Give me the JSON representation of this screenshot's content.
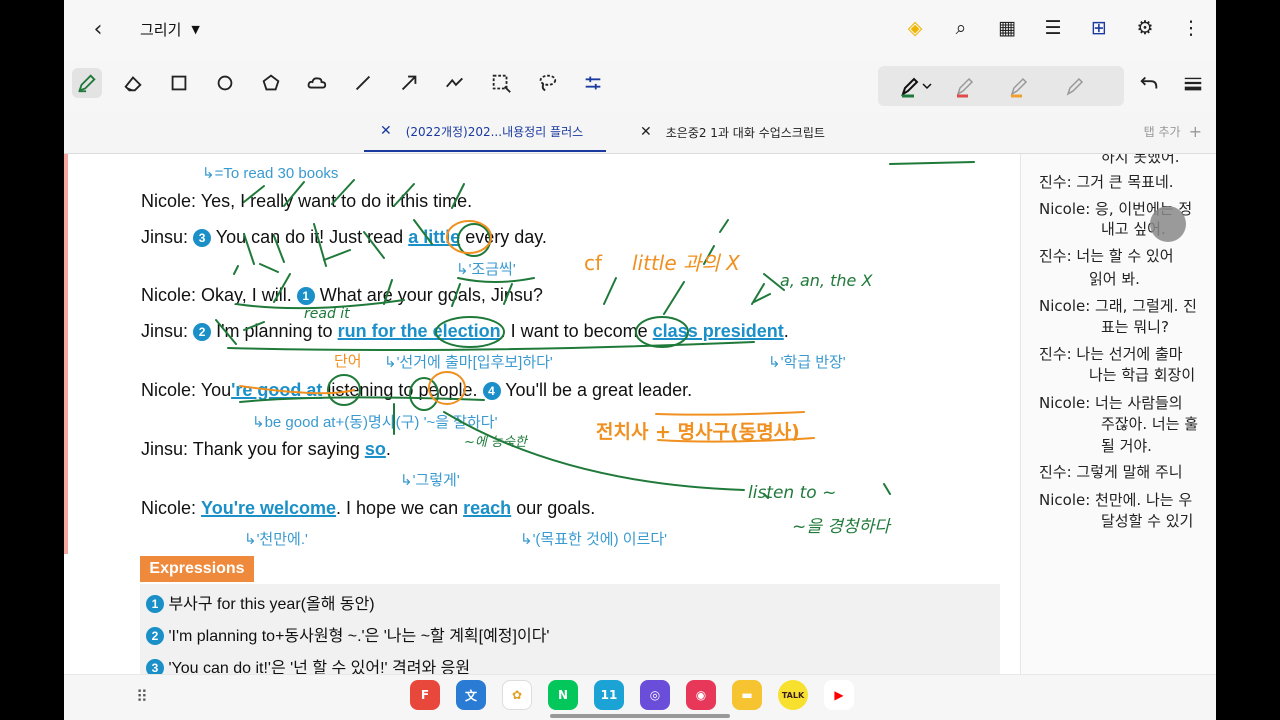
{
  "topbar": {
    "mode_label": "그리기",
    "icons": [
      "premium-diamond-icon",
      "search-icon",
      "grid-icon",
      "list-icon",
      "page-layout-icon",
      "doc-settings-icon",
      "more-icon"
    ]
  },
  "toolbar": {
    "tools": [
      "pen-icon",
      "eraser-icon",
      "rectangle-icon",
      "circle-icon",
      "pentagon-icon",
      "cloud-icon",
      "line-icon",
      "arrow-icon",
      "curve-icon",
      "select-icon",
      "lasso-icon",
      "settings-sliders-icon"
    ],
    "pen_colors": [
      "#1f7a3a",
      "#e04a4a",
      "#f0a030",
      "#b0b0b0"
    ]
  },
  "tabs": {
    "items": [
      {
        "label": "(2022개정)202...내용정리 플러스",
        "active": true
      },
      {
        "label": "초은중2 1과 대화 수업스크립트",
        "active": false
      }
    ],
    "add_label": "탭 추가"
  },
  "doc": {
    "top_note": "↳=To read 30 books",
    "lines": [
      {
        "speaker": "Nicole:",
        "text": "Yes, I really want to do it this time."
      },
      {
        "speaker": "Jinsu:",
        "num": "3",
        "pre": "You can do it! Just read ",
        "hl": "a little",
        "post": " every day."
      },
      {
        "speaker": "Nicole:",
        "pre": "Okay, I will. ",
        "num": "1",
        "post": " What are your goals, Jinsu?"
      },
      {
        "speaker": "Jinsu:",
        "num": "2",
        "pre": "I'm planning to ",
        "hl1": "run for the election",
        "mid": ". I want to become ",
        "hl2": "class president",
        "post": "."
      },
      {
        "speaker": "Nicole:",
        "pre": "You",
        "hl1": "'re good at",
        "mid": " listening to people. ",
        "num": "4",
        "post": " You'll be a great leader."
      },
      {
        "speaker": "Jinsu:",
        "pre": "Thank you for saying ",
        "hl": "so",
        "post": "."
      },
      {
        "speaker": "Nicole:",
        "hl1": "You're welcome",
        "mid": ". I hope we can ",
        "hl2": "reach",
        "post": " our goals."
      }
    ],
    "notes": {
      "a_little": "↳'조금씩'",
      "election": "↳'선거에 출마[입후보]하다'",
      "president": "↳'학급 반장'",
      "good_at": "↳be good at+(동)명사(구) '~을 잘하다'",
      "so": "↳'그렇게'",
      "welcome": "↳'천만에.'",
      "reach": "↳'(목표한 것에) 이르다'"
    },
    "expressions_title": "Expressions",
    "expressions": [
      {
        "num": "1",
        "text": "부사구 for this year(올해 동안)"
      },
      {
        "num": "2",
        "text": "'I'm planning to+동사원형 ~.'은 '나는 ~할 계획[예정]이다'"
      },
      {
        "num": "3",
        "text": "'You can do it!'은 '넌 할 수 있어!' 격려와 응원"
      }
    ]
  },
  "handwriting": {
    "cf": "cf",
    "little": "little 과의 X",
    "an_the": "a, an, the X",
    "read_it": "read it",
    "danun": "단어",
    "jeonchisa": "전치사 + 명사구(동명사)",
    "listen_to": "listen to ~",
    "gyeongcheong": "~을 경청하다",
    "eo_deungsa": "~에 능숙한"
  },
  "right_page": {
    "lines": [
      "하지 못했어.",
      "진수: 그거 큰 목표네.",
      "Nicole: 응, 이번에는 정",
      "내고 싶어.",
      "진수: 너는 할 수 있어",
      "읽어 봐.",
      "Nicole: 그래, 그럴게. 진",
      "표는 뭐니?",
      "진수: 나는 선거에 출마",
      "나는 학급 회장이",
      "Nicole: 너는 사람들의",
      "주잖아. 너는 훌",
      "될 거야.",
      "진수: 그렇게 말해 주니",
      "Nicole: 천만에. 나는 우",
      "달성할 수 있기"
    ]
  },
  "navbar": {
    "apps": [
      {
        "name": "flexcil-app-icon",
        "color": "#e8483c",
        "glyph": "F"
      },
      {
        "name": "translate-app-icon",
        "color": "#2a7bd4",
        "glyph": "文"
      },
      {
        "name": "photos-app-icon",
        "color": "#ffffff",
        "glyph": "✿"
      },
      {
        "name": "naver-app-icon",
        "color": "#03c75a",
        "glyph": "N"
      },
      {
        "name": "calendar-app-icon",
        "color": "#1ba3d6",
        "glyph": "11"
      },
      {
        "name": "browser-app-icon",
        "color": "#6a4dd8",
        "glyph": "◎"
      },
      {
        "name": "camera-app-icon",
        "color": "#e8385a",
        "glyph": "◉"
      },
      {
        "name": "files-app-icon",
        "color": "#f6c431",
        "glyph": "▬"
      },
      {
        "name": "kakaotalk-app-icon",
        "color": "#f7e12e",
        "glyph": "TALK"
      },
      {
        "name": "youtube-app-icon",
        "color": "#ffffff",
        "glyph": "▶"
      }
    ]
  }
}
